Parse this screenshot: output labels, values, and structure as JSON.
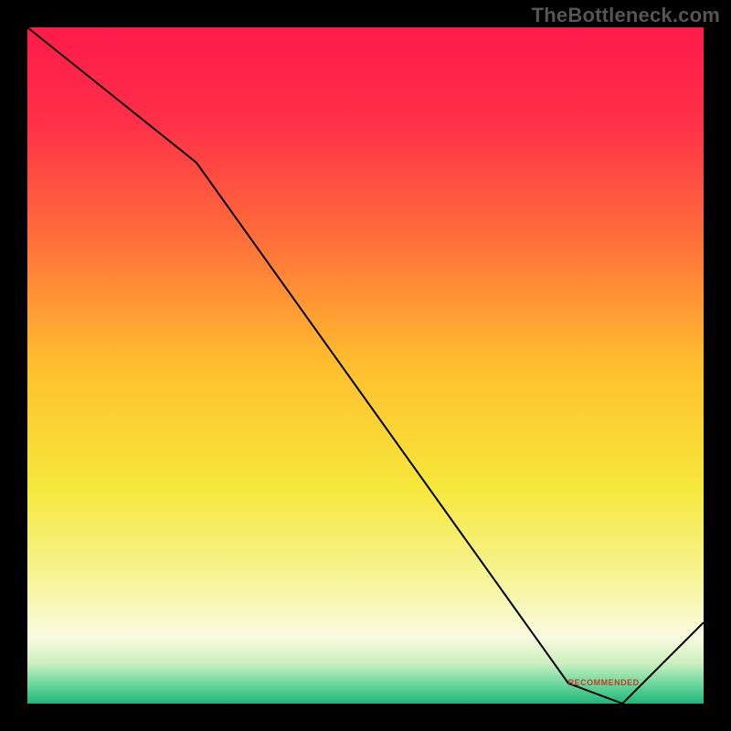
{
  "watermark": "TheBottleneck.com",
  "bottom_label": "RECOMMENDED",
  "chart_data": {
    "type": "line",
    "title": "",
    "xlabel": "",
    "ylabel": "",
    "xlim": [
      0,
      100
    ],
    "ylim": [
      0,
      100
    ],
    "x": [
      0,
      25,
      80,
      88,
      100
    ],
    "values": [
      100,
      80,
      3,
      0,
      12
    ],
    "background_gradient": {
      "stops": [
        {
          "offset": 0,
          "color": "#ff1a4a"
        },
        {
          "offset": 0.14,
          "color": "#ff3048"
        },
        {
          "offset": 0.3,
          "color": "#ff6a3a"
        },
        {
          "offset": 0.5,
          "color": "#ffbf2e"
        },
        {
          "offset": 0.68,
          "color": "#f7e83a"
        },
        {
          "offset": 0.82,
          "color": "#f6f59a"
        },
        {
          "offset": 0.9,
          "color": "#f9fbe0"
        },
        {
          "offset": 0.94,
          "color": "#cef0c0"
        },
        {
          "offset": 0.97,
          "color": "#6fd99e"
        },
        {
          "offset": 1.0,
          "color": "#1fb57a"
        }
      ]
    },
    "line_color": "#000000",
    "line_width": 2,
    "marker_band": {
      "x_start": 80,
      "x_end": 88,
      "y": 3
    }
  }
}
